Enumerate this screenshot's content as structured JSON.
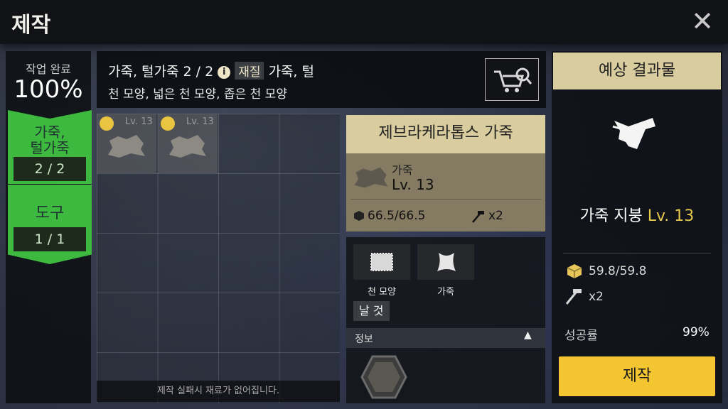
{
  "header": {
    "title": "제작",
    "close_icon": "close-icon"
  },
  "left": {
    "complete_label": "작업 완료",
    "complete_value": "100%",
    "categories": [
      {
        "label_l1": "가죽,",
        "label_l2": "털가죽",
        "count": "2 / 2"
      },
      {
        "label": "도구",
        "count": "1 / 1"
      }
    ],
    "accent": "#3cb93e"
  },
  "requirement": {
    "title": "가죽, 털가죽 2 / 2",
    "tag": "재질",
    "materials_l1": "가죽, 털",
    "materials_l2": "천 모양, 넓은 천 모양, 좁은 천 모양",
    "shop_icon": "cart-search-icon"
  },
  "grid": {
    "slots": [
      {
        "lv": "Lv. 13"
      },
      {
        "lv": "Lv. 13"
      }
    ],
    "fail_note": "제작 실패시 재료가 없어집니다."
  },
  "selected": {
    "title": "제브라케라톱스 가죽",
    "item_name": "가죽",
    "item_lv": "Lv. 13",
    "durability": "66.5/66.5",
    "hammer": "x2"
  },
  "attributes": {
    "shape_label": "천 모양",
    "material_label": "가죽",
    "blade_label": "날 것",
    "info_label": "정보"
  },
  "result": {
    "title": "예상 결과물",
    "name": "가죽 지붕",
    "lv": "Lv. 13",
    "durability": "59.8/59.8",
    "hammer": "x2",
    "rate_label": "성공률",
    "rate_value": "99%",
    "craft_label": "제작"
  },
  "colors": {
    "gold": "#f2c531",
    "parchment": "#d9cc9e",
    "level": "#e6c94a"
  }
}
